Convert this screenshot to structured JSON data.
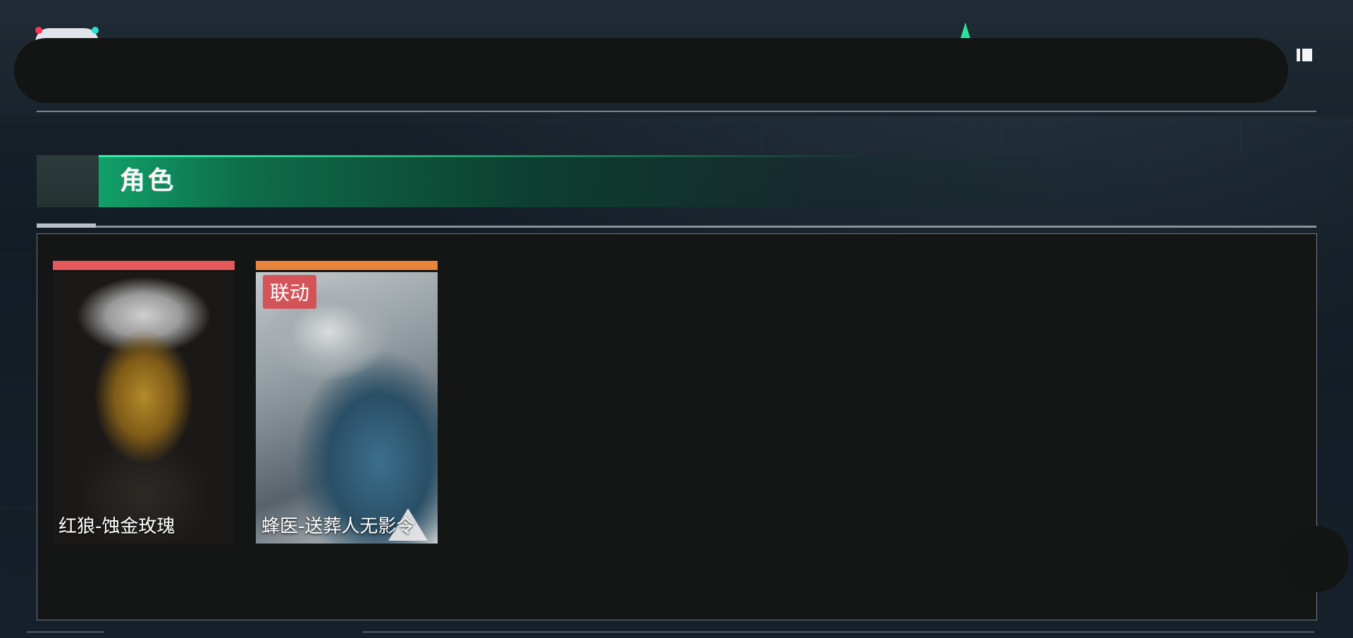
{
  "header": {
    "logo_icon": "panda-logo-icon",
    "bolt_icon": "green-bolt-icon",
    "menu_icon": "menu-panel-icon"
  },
  "section": {
    "title": "角色"
  },
  "characters": [
    {
      "name": "红狼-蚀金玫瑰",
      "rarity_color": "#e4575a",
      "badge": ""
    },
    {
      "name": "蜂医-送葬人无影令",
      "rarity_color": "#e7843a",
      "badge": "联动"
    }
  ],
  "colors": {
    "accent_green": "#2ef2a5",
    "background": "#141a21",
    "panel": "#141615"
  }
}
